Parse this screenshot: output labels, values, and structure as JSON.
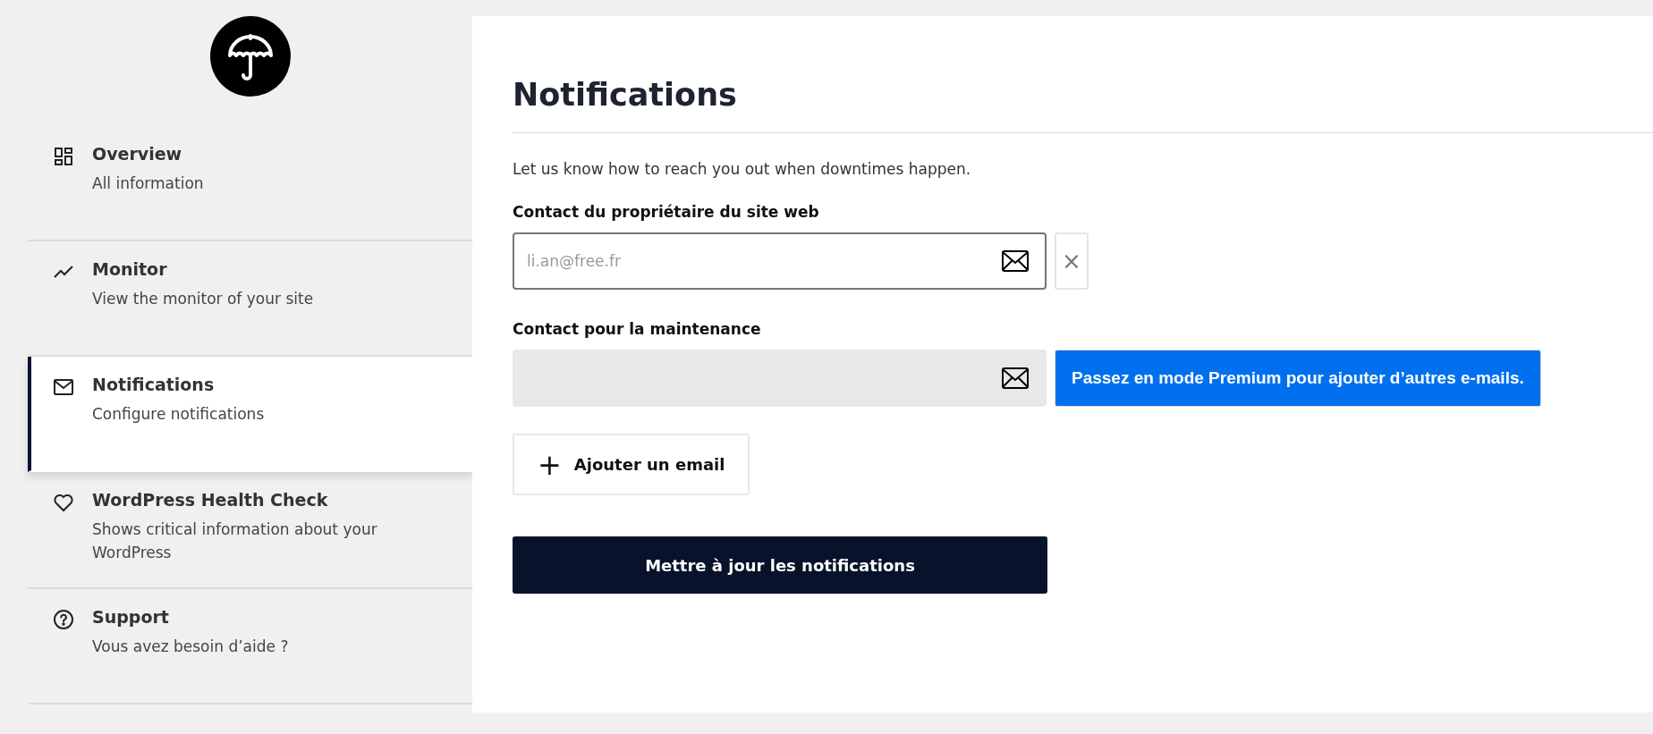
{
  "sidebar": {
    "items": [
      {
        "kind": "grid",
        "title": "Overview",
        "subtitle": "All information",
        "selected": false
      },
      {
        "kind": "chart",
        "title": "Monitor",
        "subtitle": "View the monitor of your site",
        "selected": false
      },
      {
        "kind": "mail",
        "title": "Notifications",
        "subtitle": "Configure notifications",
        "selected": true
      },
      {
        "kind": "heart",
        "title": "WordPress Health Check",
        "subtitle": "Shows critical information about your WordPress",
        "selected": false
      },
      {
        "kind": "help",
        "title": "Support",
        "subtitle": "Vous avez besoin d’aide ?",
        "selected": false
      }
    ]
  },
  "main": {
    "title": "Notifications",
    "description": "Let us know how to reach you out when downtimes happen.",
    "contacts": [
      {
        "label": "Contact du propriétaire du site web",
        "value": "li.an@free.fr",
        "disabled": false,
        "action": {
          "kind": "remove",
          "label": "×"
        }
      },
      {
        "label": "Contact pour la maintenance",
        "disabled": true,
        "action": {
          "kind": "premium",
          "label": "Passez en mode Premium pour ajouter d’autres e-mails."
        }
      }
    ],
    "add_button": {
      "icon": "+",
      "label": "Ajouter un email"
    },
    "submit_button": "Mettre à jour les notifications"
  }
}
